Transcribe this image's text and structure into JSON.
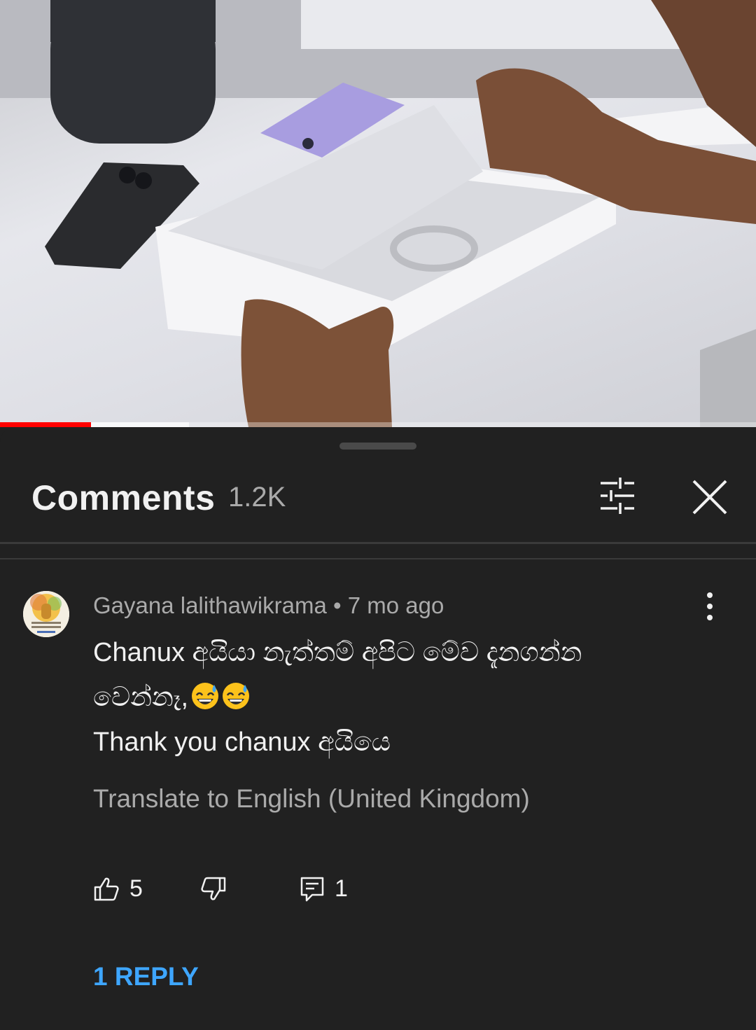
{
  "video": {
    "progress_fraction": 0.12,
    "buffer_fraction": 0.25
  },
  "comments_panel": {
    "title": "Comments",
    "count": "1.2K",
    "icons": {
      "filter": "sort-filter-icon",
      "close": "close-icon"
    }
  },
  "comment": {
    "author": "Gayana lalithawikrama",
    "separator": "•",
    "time": "7 mo ago",
    "lines": [
      "Chanux අයියා නැත්තම් අපිට මේව  දැනගන්න",
      "වෙන්නෑ,",
      "Thank you chanux අයියෙ"
    ],
    "emoji": "grinning-face-with-sweat-emoji",
    "translate_label": "Translate to English (United Kingdom)",
    "likes": "5",
    "reply_count": "1",
    "reply_link": "1 REPLY",
    "icons": {
      "like": "thumbs-up-icon",
      "dislike": "thumbs-down-icon",
      "reply": "reply-comment-icon",
      "more": "more-vert-icon",
      "avatar": "avatar"
    }
  },
  "colors": {
    "background": "#212121",
    "primary_text": "#f1f1f1",
    "secondary_text": "#aaaaaa",
    "link": "#3ea6ff",
    "progress": "#ff0000"
  }
}
